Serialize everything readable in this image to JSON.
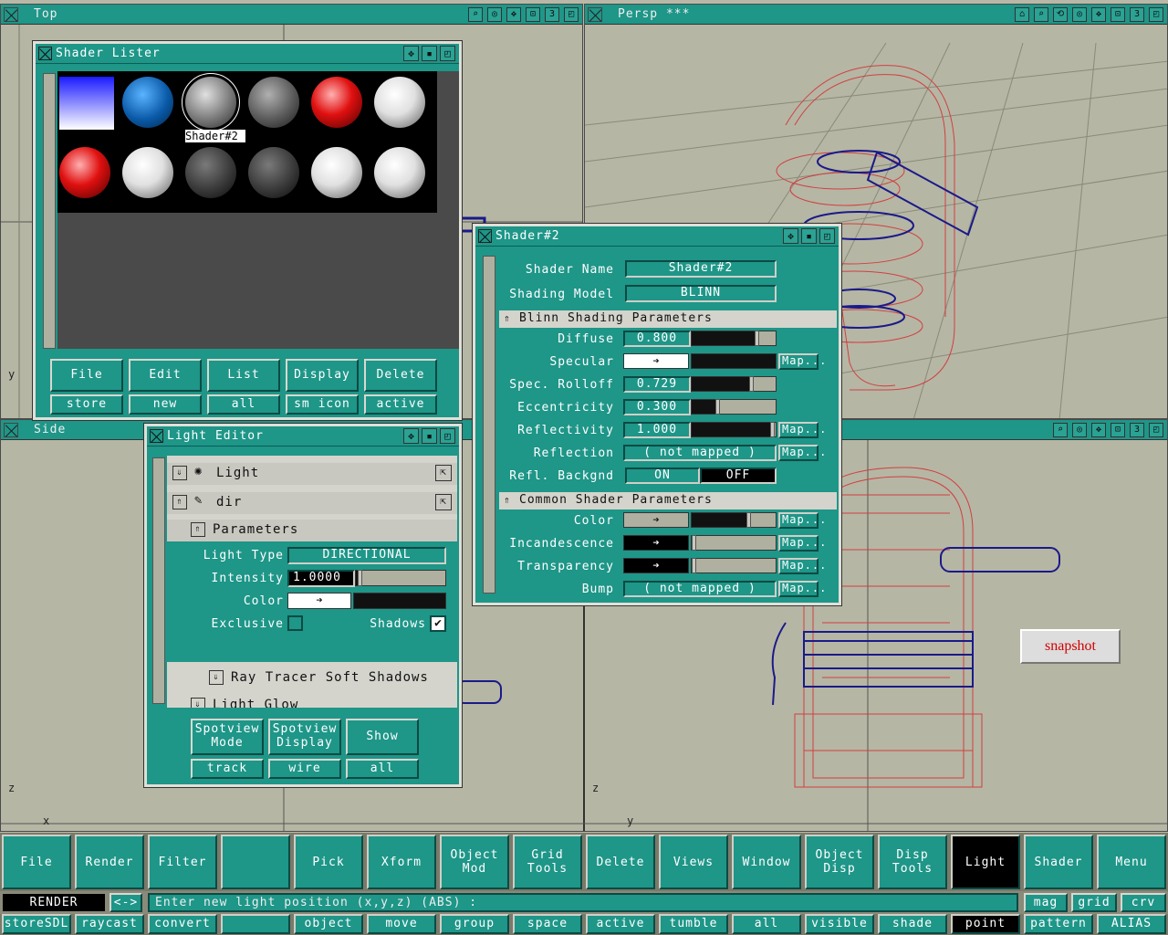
{
  "viewports": {
    "top": {
      "title": "Top",
      "layout_num": "3",
      "axis_y": "y"
    },
    "persp": {
      "title": "Persp ***",
      "layout_num": "3"
    },
    "side": {
      "title": "Side",
      "layout_num": "3",
      "axis_z": "z",
      "axis_x": "x",
      "axis_z2": "z",
      "axis_y2": "y"
    }
  },
  "shader_lister": {
    "title": "Shader Lister",
    "selected_label": "Shader#2",
    "swatches": [
      "gradient",
      "blue",
      "grey",
      "grey-dark",
      "red",
      "white",
      "red",
      "white",
      "dark",
      "dark",
      "white",
      "white"
    ],
    "buttons": [
      "File",
      "Edit",
      "List",
      "Display",
      "Delete"
    ],
    "sub_buttons": [
      "store",
      "new",
      "all",
      "sm icon",
      "active"
    ]
  },
  "light_editor": {
    "title": "Light Editor",
    "rows": {
      "light": "Light",
      "dir": "dir",
      "parameters": "Parameters",
      "light_type_label": "Light Type",
      "light_type_value": "DIRECTIONAL",
      "intensity_label": "Intensity",
      "intensity_value": "1.0000",
      "color_label": "Color",
      "exclusive_label": "Exclusive",
      "shadows_label": "Shadows",
      "ray_tracer": "Ray Tracer Soft Shadows",
      "light_glow": "Light Glow",
      "cut_row": "sub"
    },
    "buttons": [
      {
        "l1": "Spotview",
        "l2": "Mode"
      },
      {
        "l1": "Spotview",
        "l2": "Display"
      },
      {
        "l1": "Show",
        "l2": ""
      }
    ],
    "sub_buttons": [
      "track",
      "wire",
      "all"
    ]
  },
  "shader_editor": {
    "title": "Shader#2",
    "shader_name_label": "Shader Name",
    "shader_name_value": "Shader#2",
    "shading_model_label": "Shading Model",
    "shading_model_value": "BLINN",
    "blinn_section": "Blinn Shading Parameters",
    "common_section": "Common Shader Parameters",
    "map": "Map...",
    "params": {
      "diffuse": {
        "label": "Diffuse",
        "value": "0.800",
        "level": 0.8
      },
      "specular": {
        "label": "Specular"
      },
      "rolloff": {
        "label": "Spec. Rolloff",
        "value": "0.729",
        "level": 0.729
      },
      "eccentricity": {
        "label": "Eccentricity",
        "value": "0.300",
        "level": 0.3
      },
      "reflectivity": {
        "label": "Reflectivity",
        "value": "1.000",
        "level": 1.0
      },
      "reflection": {
        "label": "Reflection",
        "value": "( not mapped )"
      },
      "refl_backgnd": {
        "label": "Refl. Backgnd",
        "on": "ON",
        "off": "OFF"
      },
      "color": {
        "label": "Color"
      },
      "incandescence": {
        "label": "Incandescence"
      },
      "transparency": {
        "label": "Transparency"
      },
      "bump": {
        "label": "Bump",
        "value": "( not mapped )"
      }
    }
  },
  "snapshot": "snapshot",
  "main_menu": [
    {
      "l1": "File",
      "l2": ""
    },
    {
      "l1": "Render",
      "l2": ""
    },
    {
      "l1": "Filter",
      "l2": ""
    },
    {
      "l1": "",
      "l2": ""
    },
    {
      "l1": "Pick",
      "l2": ""
    },
    {
      "l1": "Xform",
      "l2": ""
    },
    {
      "l1": "Object",
      "l2": "Mod"
    },
    {
      "l1": "Grid",
      "l2": "Tools"
    },
    {
      "l1": "Delete",
      "l2": ""
    },
    {
      "l1": "Views",
      "l2": ""
    },
    {
      "l1": "Window",
      "l2": ""
    },
    {
      "l1": "Object",
      "l2": "Disp"
    },
    {
      "l1": "Disp",
      "l2": "Tools"
    },
    {
      "l1": "Light",
      "l2": ""
    },
    {
      "l1": "Shader",
      "l2": ""
    },
    {
      "l1": "Menu",
      "l2": ""
    }
  ],
  "status": {
    "mode": "RENDER",
    "arrows": "<->",
    "prompt": "Enter new light position (x,y,z) (ABS) :",
    "right_buttons": [
      "mag",
      "grid",
      "crv"
    ]
  },
  "bottom_bar": [
    "storeSDL",
    "raycast",
    "convert",
    "",
    "object",
    "move",
    "group",
    "space",
    "active",
    "tumble",
    "all",
    "visible",
    "shade",
    "point",
    "pattern",
    "ALIAS"
  ],
  "colors": {
    "teal": "#1e9688",
    "teal_dark": "#0b4a44",
    "viewport": "#b6b6a4",
    "wire_red": "#d04040",
    "wire_blue": "#1a1a8a"
  }
}
